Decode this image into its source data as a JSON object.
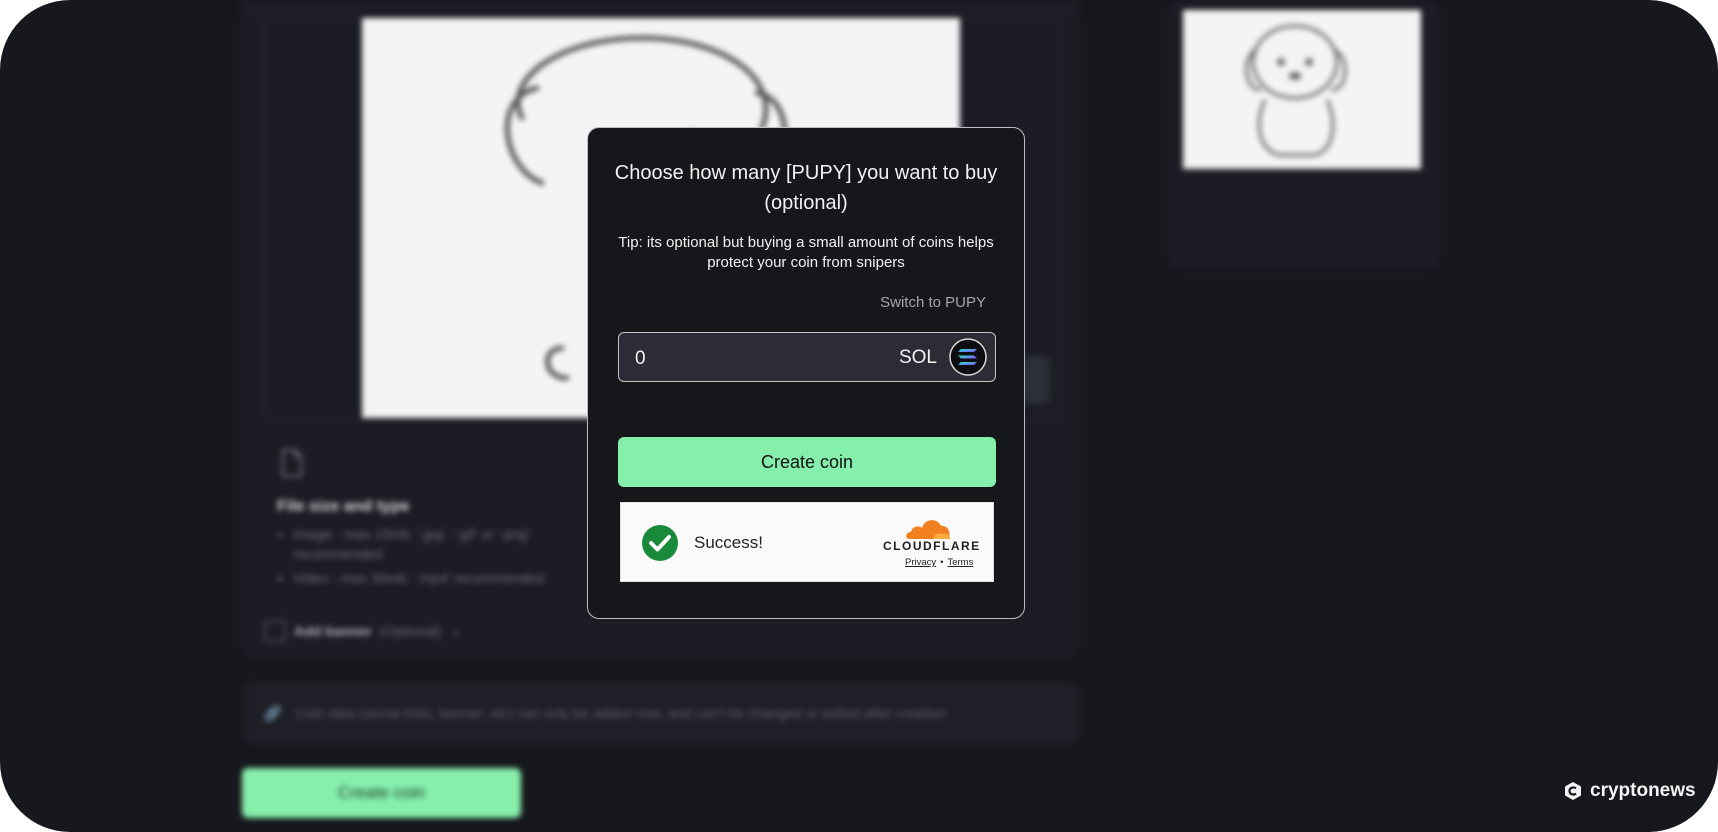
{
  "background": {
    "file_info": {
      "title": "File size and type",
      "items": [
        "Image - max 15mb. '.jpg', '.gif' or '.png' recommended",
        "Video - max 30mb. '.mp4' recommended"
      ]
    },
    "banner": {
      "label": "Add banner",
      "optional": "(Optional)"
    },
    "notice": "Coin data (social links, banner, etc) can only be added now, and can't be changed or edited after creation",
    "create_button": "Create coin"
  },
  "modal": {
    "title": "Choose how many [PUPY] you want to buy (optional)",
    "tip": "Tip: its optional but buying a small amount of coins helps protect your coin from snipers",
    "switch_link": "Switch to PUPY",
    "amount_value": "0",
    "currency": "SOL",
    "create_button": "Create coin"
  },
  "captcha": {
    "status": "Success!",
    "brand": "CLOUDFLARE",
    "privacy": "Privacy",
    "separator": "•",
    "terms": "Terms"
  },
  "watermark": "cryptonews",
  "colors": {
    "accent_green": "#86efac",
    "background": "#17181d",
    "modal_bg": "#16171b",
    "cloudflare_orange": "#f38020",
    "success_green": "#198a3a"
  },
  "icons": {
    "currency": "solana-icon",
    "captcha": "checkmark-icon",
    "brand": "cloudflare-cloud-icon",
    "file": "file-icon",
    "notice": "link-icon",
    "watermark": "cryptonews-logo-icon"
  }
}
